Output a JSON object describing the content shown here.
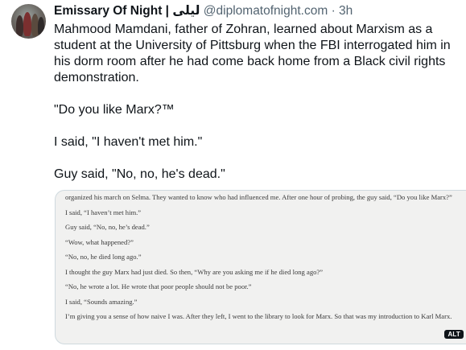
{
  "author": {
    "display_name": "Emissary Of Night | ليلى",
    "handle": "@diplomatofnight.com",
    "separator": "·",
    "time": "3h"
  },
  "post": {
    "paragraphs": [
      "Mahmood Mamdani, father of Zohran, learned about Marxism as a student at the University of Pittsburg when the FBI interrogated him in his dorm room after he had come back home from a Black civil rights demonstration.",
      "\"Do you like Marx?™",
      "I said, \"I haven't met him.\"",
      "Guy said, \"No, no, he's dead.\""
    ]
  },
  "media": {
    "lines": [
      "organized his march on Selma. They wanted to know who had influenced me. After one hour of probing, the guy said, “Do you like Marx?”",
      "I said, “I haven’t met him.”",
      "Guy said, “No, no, he’s dead.”",
      "“Wow, what happened?”",
      "“No, no, he died long ago.”",
      "I thought the guy Marx had just died. So then, “Why are you asking me if he died long ago?”",
      "“No, he wrote a lot. He wrote that poor people should not be poor.”",
      "I said, “Sounds amazing.”",
      "I’m giving you a sense of how naive I was. After they left, I went to the library to look for Marx. So that was my introduction to Karl Marx."
    ],
    "alt_badge": "ALT"
  }
}
